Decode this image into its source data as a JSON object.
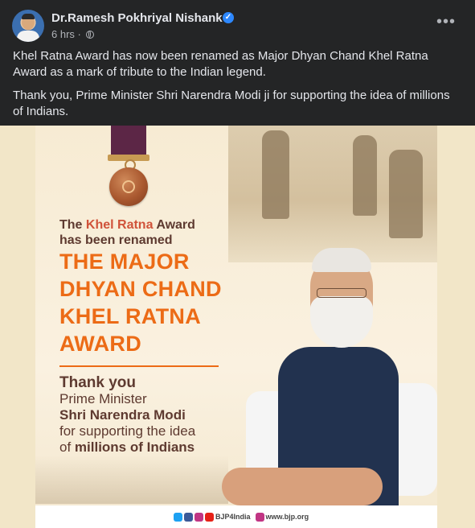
{
  "post": {
    "author": "Dr.Ramesh Pokhriyal Nishank",
    "time": "6 hrs",
    "separator": "·",
    "more_label": "•••",
    "text": [
      "Khel Ratna Award has now been renamed as Major Dhyan Chand Khel Ratna Award as a mark of tribute to the Indian legend.",
      "Thank you, Prime Minister Shri Narendra Modi ji for supporting the idea of millions of Indians."
    ],
    "icons": {
      "verified": "verified-badge-icon",
      "audience": "globe-icon",
      "more": "more-options-icon"
    }
  },
  "poster": {
    "line1_prefix": "The ",
    "line1_accent": "Khel Ratna",
    "line1_suffix": " Award",
    "line2": "has been renamed",
    "title_lines": [
      "THE MAJOR",
      "DHYAN CHAND",
      "KHEL RATNA",
      "AWARD"
    ],
    "thanks": "Thank you",
    "pm_line1": "Prime Minister",
    "pm_line2": "Shri Narendra Modi",
    "pm_line3": "for supporting the idea",
    "pm_line4_prefix": "of ",
    "pm_line4_strong": "millions of Indians",
    "footer_handle": "BJP4India",
    "footer_site": "www.bjp.org",
    "colors": {
      "accent_orange": "#ec6b16",
      "accent_red": "#d0533a",
      "text_brown": "#5e3a30",
      "ribbon": "#5c2646"
    }
  }
}
